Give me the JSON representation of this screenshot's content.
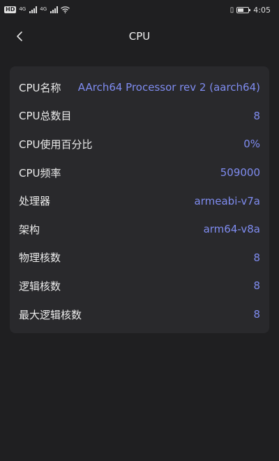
{
  "status_bar": {
    "hd_badge": "HD",
    "sim1_label": "4G",
    "sim2_label": "4G",
    "battery_level": 0.55,
    "time": "4:05"
  },
  "header": {
    "title": "CPU",
    "back_icon": "chevron-left-icon"
  },
  "colors": {
    "background": "#1f1f21",
    "card": "#29292c",
    "value_accent": "#7f8cf0"
  },
  "cpu_info": [
    {
      "label": "CPU名称",
      "value": "AArch64 Processor rev 2 (aarch64)"
    },
    {
      "label": "CPU总数目",
      "value": "8"
    },
    {
      "label": "CPU使用百分比",
      "value": "0%"
    },
    {
      "label": "CPU频率",
      "value": "509000"
    },
    {
      "label": "处理器",
      "value": "armeabi-v7a"
    },
    {
      "label": "架构",
      "value": "arm64-v8a"
    },
    {
      "label": "物理核数",
      "value": "8"
    },
    {
      "label": "逻辑核数",
      "value": "8"
    },
    {
      "label": "最大逻辑核数",
      "value": "8"
    }
  ]
}
